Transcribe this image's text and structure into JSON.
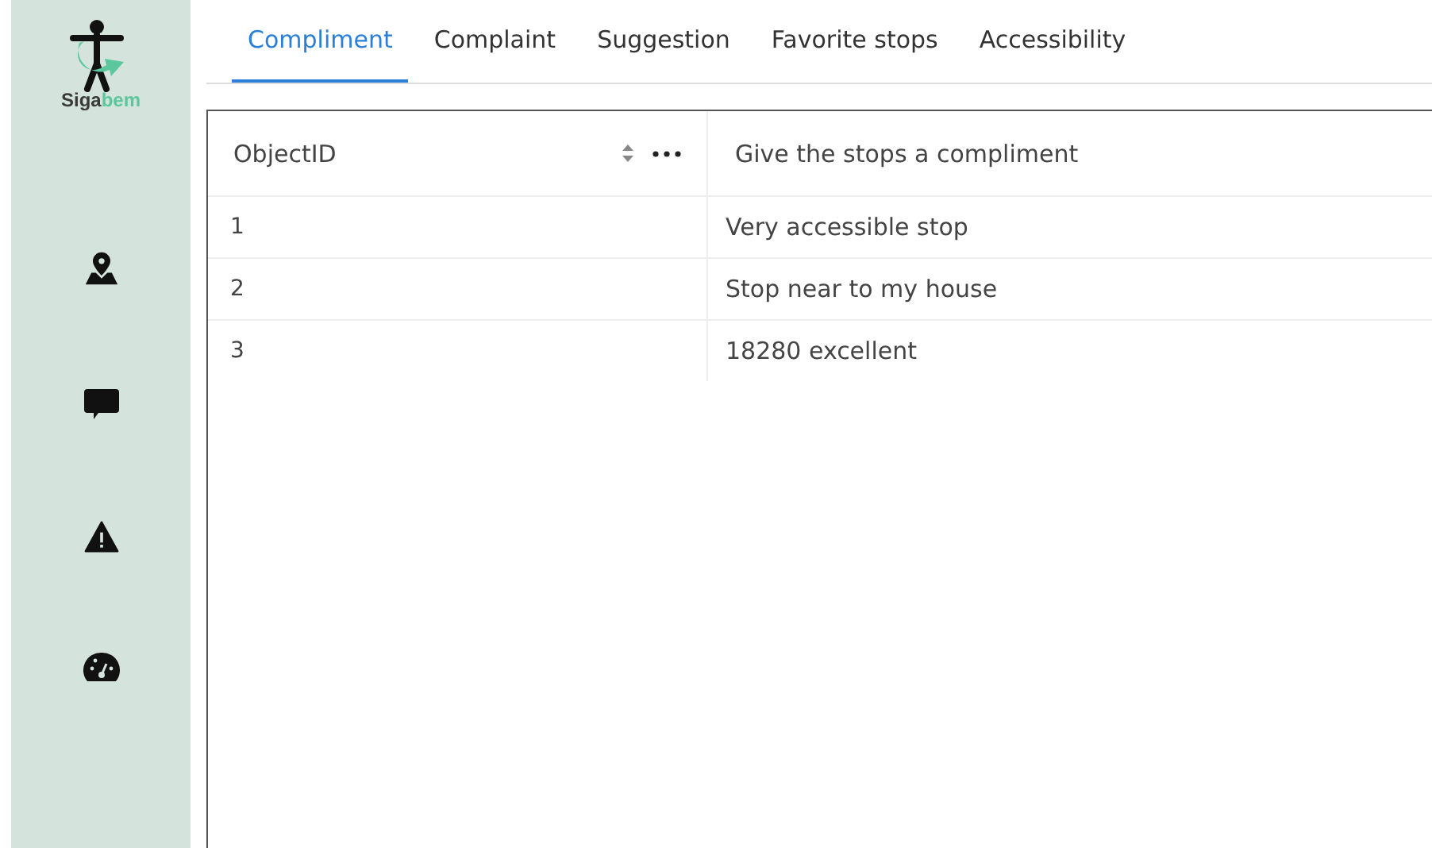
{
  "sidebar": {
    "logo_text": [
      {
        "text": "Siga",
        "color": "#3a3a3a"
      },
      {
        "text": "bem",
        "color": "#5cc79c"
      }
    ],
    "items": [
      {
        "kind": "map"
      },
      {
        "kind": "comment"
      },
      {
        "kind": "warning"
      },
      {
        "kind": "gauge"
      }
    ]
  },
  "tabs": [
    {
      "label": "Compliment",
      "selected": true
    },
    {
      "label": "Complaint",
      "selected": false
    },
    {
      "label": "Suggestion",
      "selected": false
    },
    {
      "label": "Favorite stops",
      "selected": false
    },
    {
      "label": "Accessibility",
      "selected": false
    }
  ],
  "table": {
    "columns": [
      "ObjectID",
      "Give the stops a compliment"
    ],
    "rows": [
      [
        "1",
        "Very accessible stop"
      ],
      [
        "2",
        "Stop near to my house"
      ],
      [
        "3",
        "18280 excellent"
      ]
    ]
  }
}
